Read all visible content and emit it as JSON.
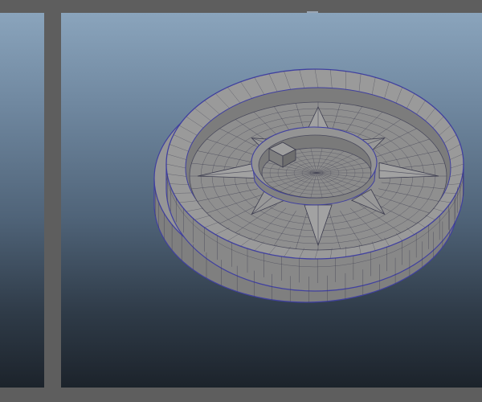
{
  "app": {
    "window": "3d-modeling-viewport",
    "layout": "two-pane"
  },
  "colors": {
    "frame": "#5e5e5e",
    "viewport_gradient_top": "#8aa4bc",
    "viewport_gradient_bottom": "#1c232b",
    "mesh_face": "#8e8e8e",
    "mesh_wire": "#3c3c4e",
    "mesh_border": "#4040a0"
  },
  "scene": {
    "object": "compass-rose-disc-model",
    "display_mode": "wireframe-on-shaded",
    "rose_points": 8
  }
}
